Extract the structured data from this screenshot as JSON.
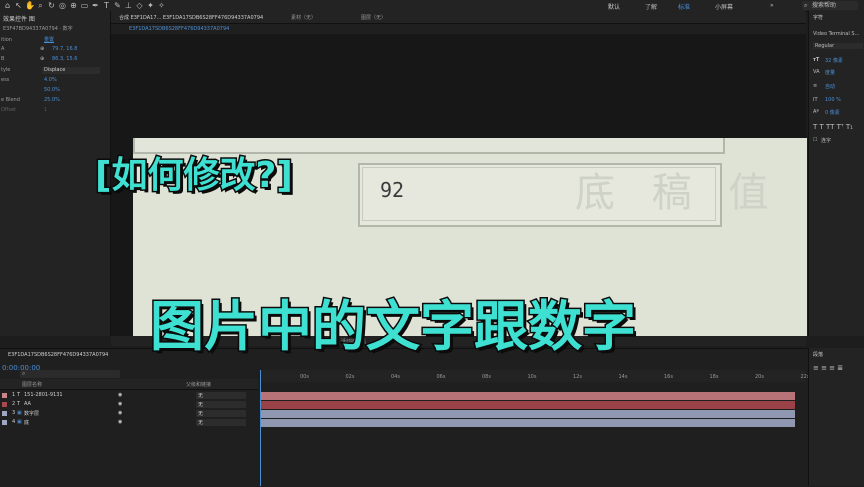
{
  "toolbar": {
    "workspaces": [
      "默认",
      "了解",
      "标准",
      "小屏幕"
    ],
    "search_placeholder": "搜索帮助"
  },
  "effect_panel": {
    "tab_label": "效果控件 图",
    "layer_path": "E3F47BD94337A0794 · 数字",
    "reset_label": "重置",
    "rows": [
      {
        "k": "ition",
        "v": ""
      },
      {
        "k": "A",
        "v": "79.7, 16.8"
      },
      {
        "k": "B",
        "v": "86.3, 15.6"
      },
      {
        "k": "tyle",
        "v": "Displace"
      },
      {
        "k": "ess",
        "v": "4.0%"
      },
      {
        "k": "",
        "v": "50.0%"
      },
      {
        "k": "e Blend",
        "v": "25.0%"
      },
      {
        "k": "Offset",
        "v": "1"
      }
    ]
  },
  "comp": {
    "tab_label": "合成 E3F1DA17... E3F1DA17SDB6S28FF476D94337A0794",
    "footage_label": "素材（无）",
    "layer_label": "图层（无）",
    "sub_tab": "E3F1DA17SDB6S28FF476D94337A0794",
    "number_text": "92",
    "ghost_text": "底 稿 值"
  },
  "comp_footer": {
    "zoom": "活动摄像机",
    "views": "1个..."
  },
  "right_panel": {
    "title": "字符",
    "font": "Video Terminal S...",
    "style": "Regular",
    "size": "32 像素",
    "leading": "自动",
    "kerning": "度量",
    "tracking": "0",
    "vscale": "100 %",
    "hscale": "100 %",
    "baseline": "0 像素",
    "tsume": "0 %",
    "ligatures": "连字"
  },
  "timeline": {
    "tab_label": "E3F1DA17SDB6S28FF476D94337A0794",
    "current_time": "0:00:00:00",
    "col_source": "图层名称",
    "col_parent": "父级和链接",
    "ticks": [
      "00s",
      "02s",
      "04s",
      "06s",
      "08s",
      "10s",
      "12s",
      "14s",
      "16s",
      "18s",
      "20s",
      "22s"
    ],
    "layers": [
      {
        "idx": "1",
        "type": "T",
        "name": "151-2801-9131",
        "parent": "无",
        "color": "#c8868a"
      },
      {
        "idx": "2",
        "type": "T",
        "name": "AA",
        "parent": "无",
        "color": "#a6484e"
      },
      {
        "idx": "3",
        "type": "img",
        "name": "数字层",
        "parent": "无",
        "color": "#9da6c4"
      },
      {
        "idx": "4",
        "type": "img",
        "name": "底",
        "parent": "无",
        "color": "#9da6c4"
      }
    ]
  },
  "right_bottom": {
    "title": "段落"
  },
  "captions": {
    "question": "[如何修改?]",
    "headline": "图片中的文字跟数字"
  }
}
